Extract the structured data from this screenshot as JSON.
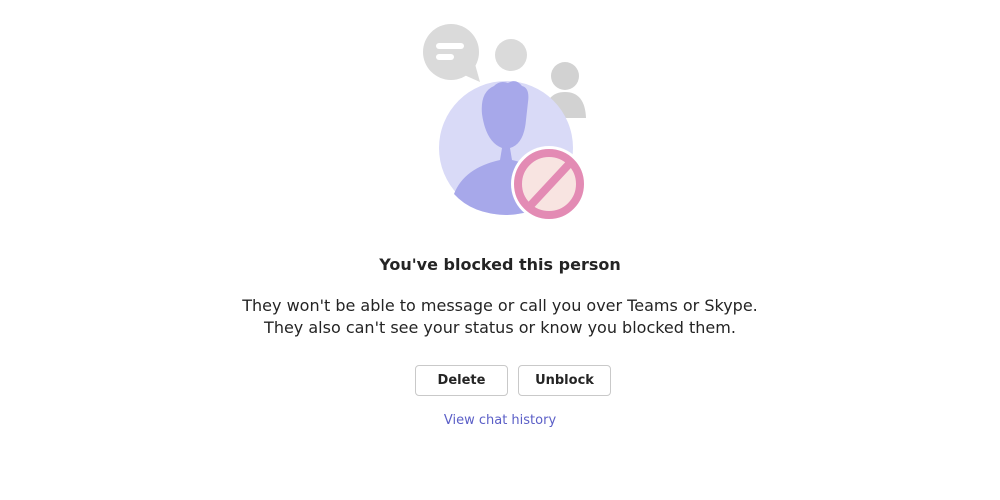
{
  "blocked_panel": {
    "title": "You've blocked this person",
    "description_lines": [
      "They won't be able to message or call you over Teams or Skype.",
      "They also can't see your status or know you blocked them."
    ],
    "buttons": {
      "delete_label": "Delete",
      "unblock_label": "Unblock"
    },
    "link_label": "View chat history"
  },
  "illustration": {
    "icons": [
      "chat-bubble-icon",
      "people-icon",
      "person-avatar-icon",
      "block-icon"
    ],
    "colors": {
      "avatar_circle": "#d9daf7",
      "avatar_person": "#a7a8ea",
      "gray_icons": "#dadada",
      "block_ring": "#e38bb4",
      "block_fill": "#f8e4e1"
    }
  },
  "colors": {
    "text": "#242424",
    "link": "#5b5fc7",
    "button_border": "#c9c9c9"
  }
}
